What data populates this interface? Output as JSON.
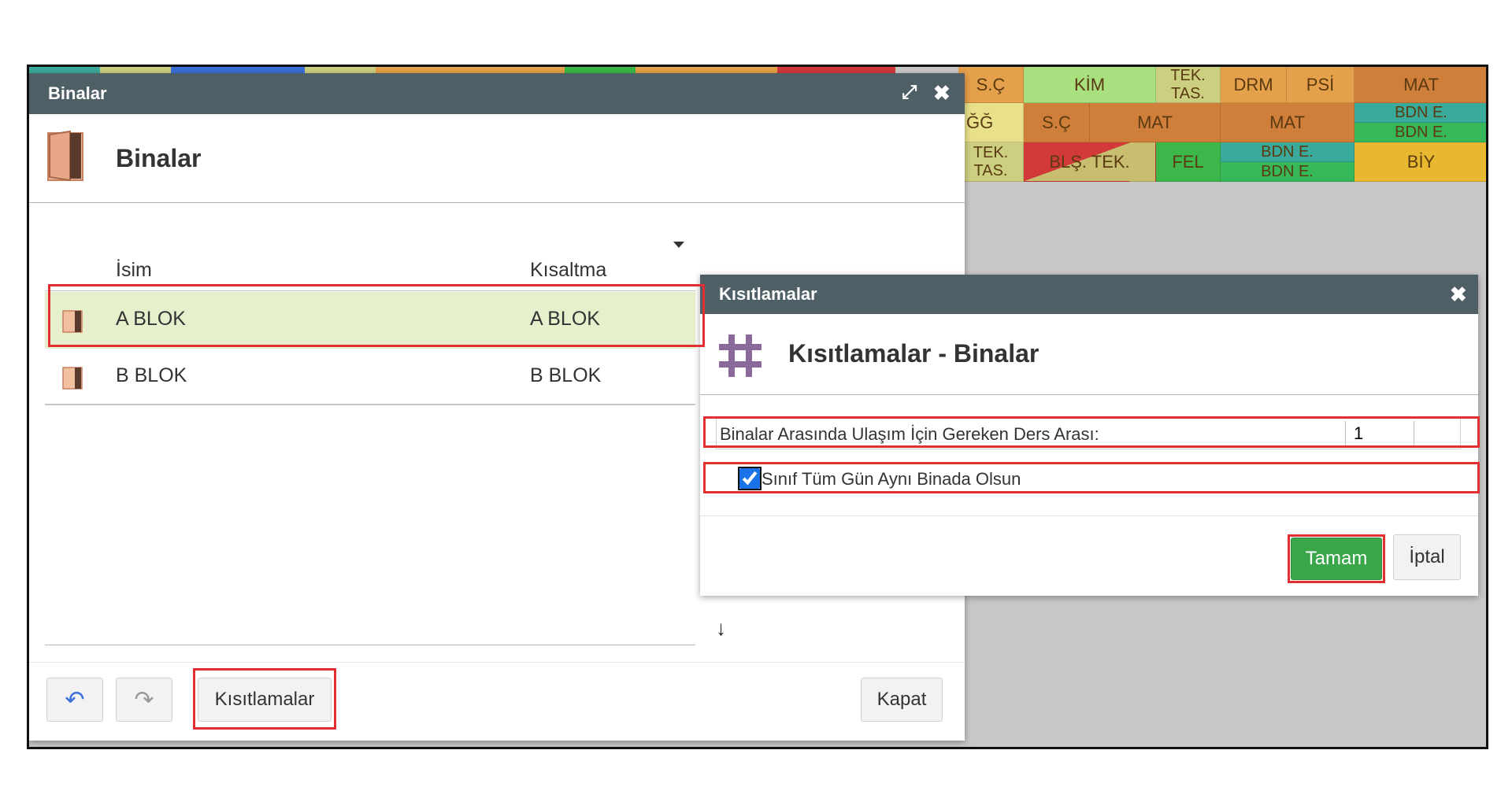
{
  "timetable": {
    "cells": [
      {
        "t": "S.Ç",
        "bg": "#e4a04a"
      },
      {
        "t": "KİM",
        "bg": "#a8e080"
      },
      {
        "t": "TEK.\nTAS.",
        "bg": "#cccf80"
      },
      {
        "t": "DRM",
        "bg": "#e4a04a"
      },
      {
        "t": "PSİ",
        "bg": "#e4a04a"
      },
      {
        "t": "MAT",
        "bg": "#cf7f3a"
      },
      {
        "t": "ĞĞ",
        "bg": "#e8e08a"
      },
      {
        "t": "S.Ç",
        "bg": "#cf7f3a"
      },
      {
        "t": "MAT",
        "bg": "#cf7f3a"
      },
      {
        "t": "MAT",
        "bg": "#cf7f3a"
      },
      {
        "t": "BDN E.",
        "bg": "#3aaa9a"
      },
      {
        "t": "BDN E.",
        "bg": "#36b85a"
      },
      {
        "t": "TEK.\nTAS.",
        "bg": "#cccf80"
      },
      {
        "t": "BLŞ. TEK.",
        "bg": "#c8be70"
      },
      {
        "t": "FEL",
        "bg": "#3cb84a"
      },
      {
        "t": "BDN E.",
        "bg": "#3aaa9a"
      },
      {
        "t": "BDN E.",
        "bg": "#36b85a"
      },
      {
        "t": "BİY",
        "bg": "#e8b830"
      }
    ]
  },
  "binalar_window": {
    "title": "Binalar",
    "header": "Binalar",
    "columns": {
      "name": "İsim",
      "short": "Kısaltma"
    },
    "rows": [
      {
        "name": "A BLOK",
        "short": "A BLOK"
      },
      {
        "name": "B BLOK",
        "short": "B BLOK"
      }
    ],
    "buttons": {
      "constraints": "Kısıtlamalar",
      "close": "Kapat"
    }
  },
  "kisitlamalar_window": {
    "title": "Kısıtlamalar",
    "header": "Kısıtlamalar - Binalar",
    "field_label": "Binalar Arasında Ulaşım İçin Gereken Ders Arası:",
    "field_value": "1",
    "checkbox_label": "Sınıf Tüm Gün Aynı Binada Olsun",
    "checkbox_checked": true,
    "buttons": {
      "ok": "Tamam",
      "cancel": "İptal"
    }
  },
  "colors": {
    "titlebar": "#4e5f66",
    "selected_row": "#e6f0cc",
    "ok_button": "#3aa64a",
    "highlight": "#e03030"
  }
}
